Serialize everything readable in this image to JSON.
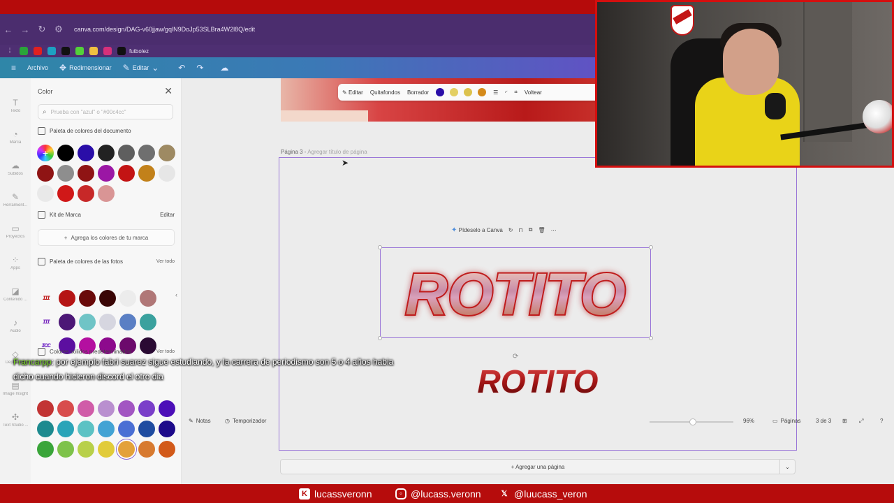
{
  "browser": {
    "url": "canva.com/design/DAG-v60jjaw/gqlN9DoJp53SLBra4W2l8Q/edit",
    "bookmark_label": "futbolez"
  },
  "canva_toolbar": {
    "menu_icon": "hamburger-icon",
    "file_label": "Archivo",
    "resize_label": "Redimensionar",
    "edit_label": "Editar"
  },
  "rail": {
    "items": [
      {
        "icon": "T",
        "label": "Texto"
      },
      {
        "icon": "◔",
        "label": "Marca"
      },
      {
        "icon": "☁",
        "label": "Subidos"
      },
      {
        "icon": "✎",
        "label": "Herramient..."
      },
      {
        "icon": "▭",
        "label": "Proyectos"
      },
      {
        "icon": "⁘",
        "label": "Apps"
      },
      {
        "icon": "◪",
        "label": "Contenido ..."
      },
      {
        "icon": "♪",
        "label": "Audio"
      },
      {
        "icon": "◇",
        "label": "Depth Text"
      },
      {
        "icon": "▤",
        "label": "Image Insight"
      },
      {
        "icon": "✣",
        "label": "Text Studio ..."
      }
    ]
  },
  "color_panel": {
    "title": "Color",
    "search_placeholder": "Prueba con \"azul\" o \"#00c4cc\"",
    "doc_palette_title": "Paleta de colores del documento",
    "doc_palette_rows": [
      [
        "#000000",
        "#2a0ea8",
        "#222222",
        "#5f5f5f",
        "#6f6f6f",
        "#9e8a63"
      ],
      [
        "#8f1414",
        "#8e8e8e",
        "#8f1414",
        "#9b17a5",
        "#c31414",
        "#c2811a",
        "#e6e6e6"
      ],
      [
        "#e9e9e9",
        "#d01818",
        "#c72828",
        "#d99595"
      ]
    ],
    "brand_kit_title": "Kit de Marca",
    "brand_kit_edit": "Editar",
    "brand_add_label": "Agrega los colores de tu marca",
    "photo_palette_title": "Paleta de colores de las fotos",
    "photo_palette_more": "Ver todo",
    "photo_rows": [
      {
        "thumb": "ɪɪɪ",
        "thumb_color": "#c01c1c",
        "colors": [
          "#b51515",
          "#6a0a0a",
          "#3a0606",
          "#ececec",
          "#b07777"
        ]
      },
      {
        "thumb": "ɪɪɪ",
        "thumb_color": "#7a2cbf",
        "colors": [
          "#4c1776",
          "#6fc4c6",
          "#d6d6e0",
          "#5a7fc4",
          "#3aa19e"
        ]
      },
      {
        "thumb": "ɪcc",
        "thumb_color": "#6b1fc4",
        "colors": [
          "#5c0fa0",
          "#b40fa0",
          "#8d0a8d",
          "#6c0a6c",
          "#2a0a33"
        ]
      }
    ],
    "solid_title": "Colores sólidos predeterminados",
    "solid_more": "Ver todo",
    "solid_rows": [
      [
        "#c23434",
        "#d84c4c",
        "#d05ca8",
        "#b98fcf",
        "#a256c2",
        "#7a3fc9",
        "#4c0fb8"
      ],
      [
        "#1d8a8f",
        "#2aa4b8",
        "#5cc2c4",
        "#43a3d4",
        "#4a6fd4",
        "#1f4ca0",
        "#1d0a8a"
      ],
      [
        "#3aa53a",
        "#7ec24a",
        "#b8d04a",
        "#e1cb3a",
        "#e3a13a",
        "#d77a30",
        "#d25a1a"
      ]
    ],
    "collapse_icon": "chevron-left-icon"
  },
  "canvas": {
    "context_toolbar": {
      "edit_label": "Editar",
      "bg_remove_label": "Quitafondos",
      "eraser_label": "Borrador",
      "flip_label": "Voltear",
      "colors": [
        "#2a0ea8",
        "#e3cf63",
        "#dcc24d",
        "#d48a1a"
      ]
    },
    "page_label": "Página 3 -",
    "page_title_placeholder": "Agregar título de página",
    "ask_canva_label": "Pídeselo a Canva",
    "text_main": "ROTITO",
    "text_secondary": "ROTITO",
    "add_page_label": "+ Agregar una página"
  },
  "bottom_bar": {
    "notes_label": "Notas",
    "timer_label": "Temporizador",
    "zoom_level": "96%",
    "zoom_fraction": 0.52,
    "pages_label": "Páginas",
    "page_count": "3 de 3"
  },
  "chat": {
    "username": "Francarpp",
    "message": ": por ejemplo fabri suarez sigue estudiando, y la carrera de periodismo son 5 o 4 años habia dicho cuando hicieron discord el otro dia"
  },
  "social": {
    "kick": "lucassveronn",
    "instagram": "@lucass.veronn",
    "x": "@luucass_veron"
  },
  "colors": {
    "stream_red": "#b60c0c",
    "canva_purple": "#9a76d8"
  }
}
